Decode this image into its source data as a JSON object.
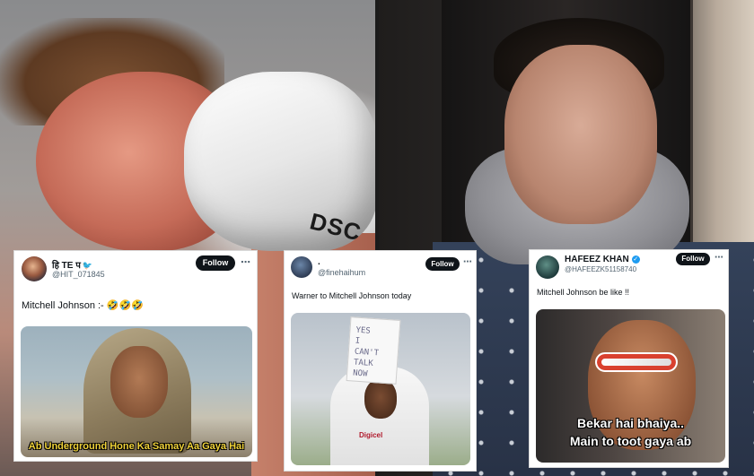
{
  "background": {
    "left_photo": {
      "glove_brand": "DSC"
    },
    "right_photo": {}
  },
  "tweets": [
    {
      "display_name": "हि TE प",
      "handle": "@HIT_071845",
      "follow_label": "Follow",
      "text": "Mitchell Johnson :- 🤣🤣🤣",
      "media_caption": "Ab Underground Hone Ka Samay Aa Gaya Hai"
    },
    {
      "display_name": ".",
      "handle": "@finehaihum",
      "follow_label": "Follow",
      "text": "Warner to Mitchell Johnson today",
      "media_sign": "YES\nI\nCAN'T\nTALK\nNOW",
      "media_logo": "Digicel"
    },
    {
      "display_name": "HAFEEZ KHAN",
      "handle": "@HAFEEZK51158740",
      "follow_label": "Follow",
      "text": "Mitchell Johnson be like !!",
      "media_caption_line1": "Bekar hai bhaiya..",
      "media_caption_line2": "Main to toot gaya ab"
    }
  ],
  "icons": {
    "more": "more-horizontal-icon",
    "verified": "verified-badge-icon",
    "bird": "bird-icon"
  },
  "colors": {
    "follow_button": "#0f1419",
    "handle_text": "#536471",
    "verified": "#1d9bf0",
    "meme1_caption": "#f1d33a"
  }
}
